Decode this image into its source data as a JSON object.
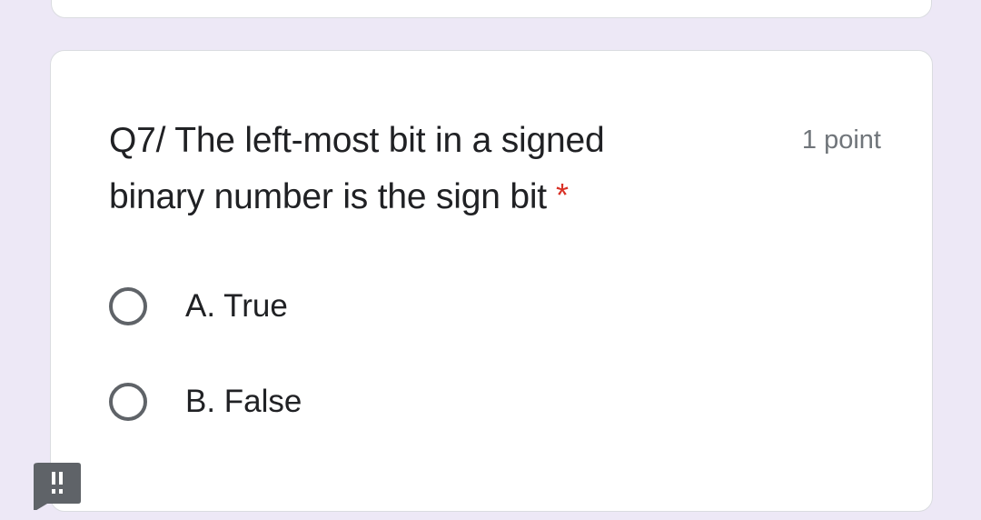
{
  "question": {
    "text": "Q7/ The left-most bit in a signed binary number is the sign bit",
    "required_marker": "*",
    "points": "1 point"
  },
  "options": [
    {
      "label": "A. True",
      "selected": false
    },
    {
      "label": "B. False",
      "selected": false
    }
  ],
  "icons": {
    "report": "report-problem-icon"
  },
  "colors": {
    "background": "#ede8f6",
    "card": "#ffffff",
    "required": "#d93025",
    "radio_border": "#5f6368",
    "text": "#202124",
    "secondary_text": "#70757a"
  }
}
